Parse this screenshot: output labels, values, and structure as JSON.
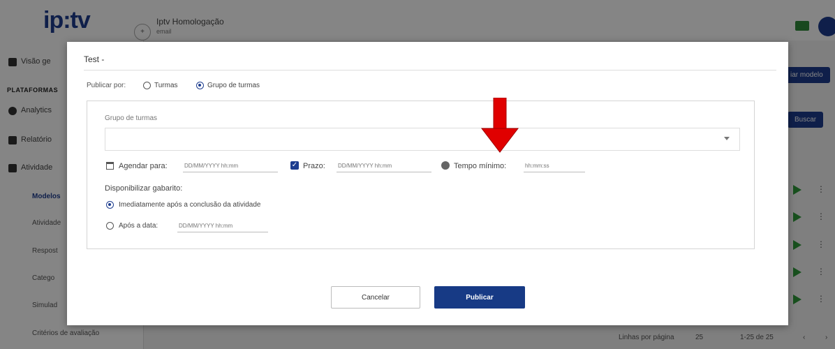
{
  "app": {
    "logo": "ip:tv",
    "environment": {
      "name": "Iptv Homologação",
      "subtitle": "email",
      "button": "+"
    },
    "sidebar": {
      "items": [
        {
          "label": "Visão ge"
        },
        {
          "label": "Analytics"
        },
        {
          "label": "Relatório"
        },
        {
          "label": "Atividade"
        }
      ],
      "section": "PLATAFORMAS",
      "sub_items": [
        "Modelos",
        "Atividade",
        "Respost",
        "Catego",
        "Simulad",
        "Critérios de avaliação"
      ]
    },
    "content": {
      "create_model_button": "iar modelo",
      "search_button": "Buscar",
      "rows_per_page_label": "Linhas por página",
      "rows_per_page_value": "25",
      "page_range": "1-25 de 25"
    }
  },
  "modal": {
    "title": "Test -",
    "publish_by_label": "Publicar por:",
    "publish_options": [
      {
        "label": "Turmas",
        "checked": false
      },
      {
        "label": "Grupo de turmas",
        "checked": true
      }
    ],
    "group_field": {
      "label": "Grupo de turmas",
      "value": ""
    },
    "schedule": {
      "label": "Agendar para:",
      "placeholder": "DD/MM/YYYY hh:mm"
    },
    "deadline": {
      "label": "Prazo:",
      "placeholder": "DD/MM/YYYY hh:mm",
      "checked": true
    },
    "min_time": {
      "label": "Tempo mínimo:",
      "placeholder": "hh:mm:ss"
    },
    "answer_key": {
      "label": "Disponibilizar gabarito:",
      "options": [
        {
          "label": "Imediatamente após a conclusão da atividade",
          "checked": true
        },
        {
          "label": "Após a data:",
          "checked": false,
          "placeholder": "DD/MM/YYYY hh:mm"
        }
      ]
    },
    "cancel_button": "Cancelar",
    "publish_button": "Publicar"
  },
  "colors": {
    "primary": "#173a85",
    "annotation_arrow": "#e00000",
    "overlay": "rgba(0,0,0,0.48)"
  }
}
